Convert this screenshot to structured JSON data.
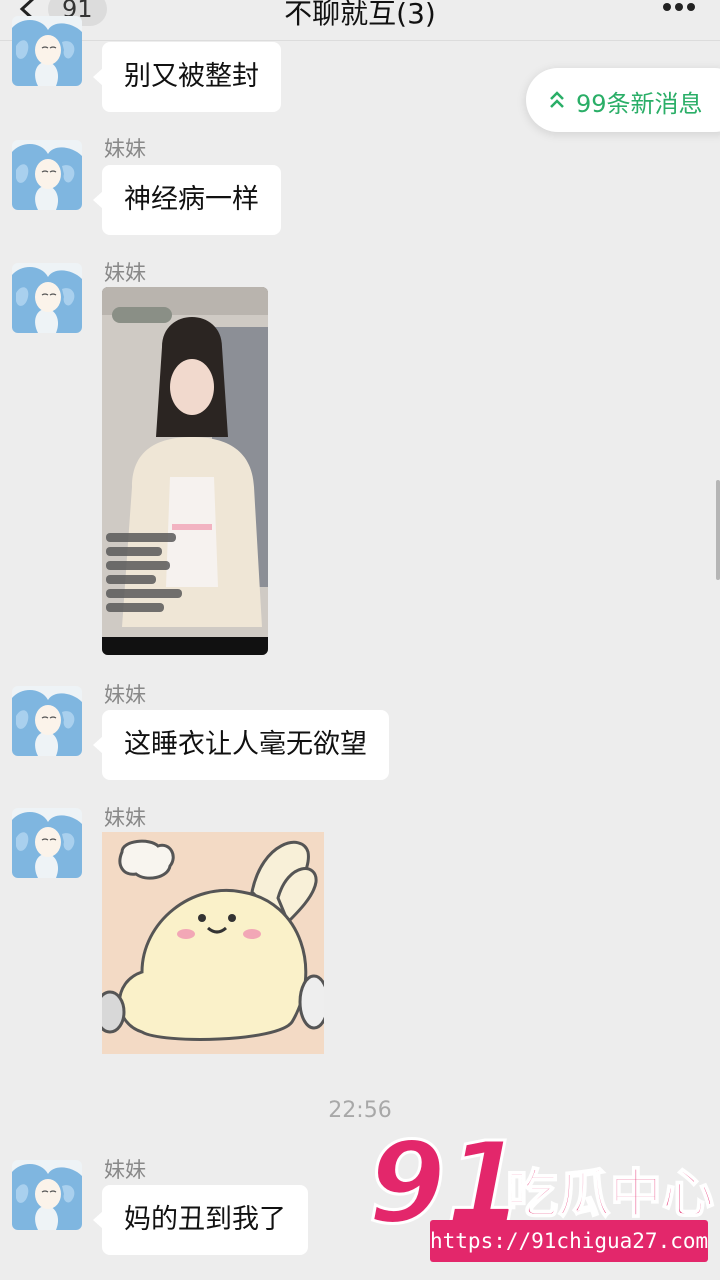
{
  "header": {
    "unread_count": "91",
    "title": "不聊就互(3)"
  },
  "new_messages_pill": {
    "text": "99条新消息"
  },
  "messages": [
    {
      "sender": "",
      "text": "别又被整封"
    },
    {
      "sender": "妹妹",
      "text": "神经病一样"
    },
    {
      "sender": "妹妹",
      "type": "image"
    },
    {
      "sender": "妹妹",
      "text": "这睡衣让人毫无欲望"
    },
    {
      "sender": "妹妹",
      "type": "sticker"
    },
    {
      "sender": "妹妹",
      "text": "妈的丑到我了"
    }
  ],
  "timestamp": "22:56",
  "watermark": {
    "logo_text": "91吃瓜中心",
    "url": "https://91chigua27.com"
  },
  "colors": {
    "background": "#ededed",
    "bubble": "#ffffff",
    "pill_text": "#2aae67",
    "watermark": "#e3276b"
  }
}
